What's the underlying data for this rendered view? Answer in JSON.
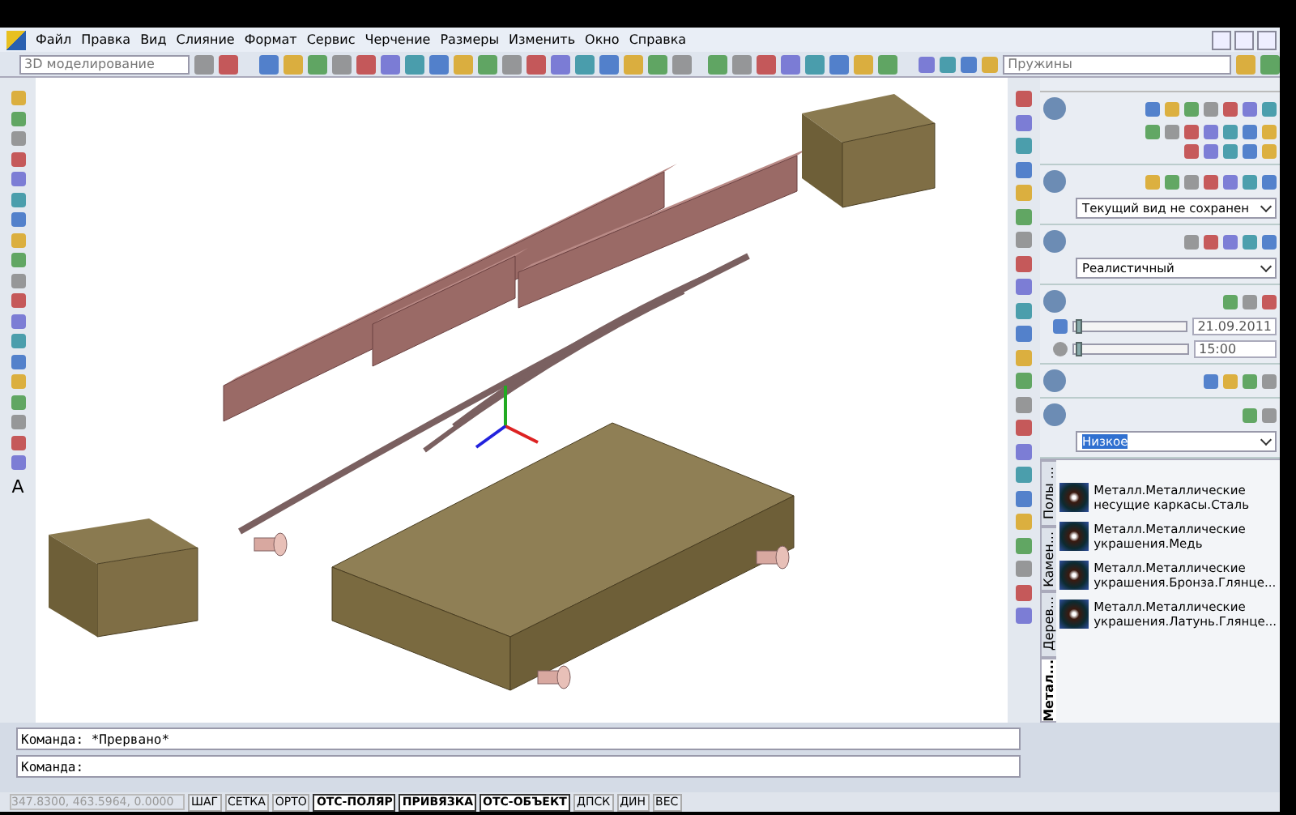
{
  "menu": [
    "Файл",
    "Правка",
    "Вид",
    "Слияние",
    "Формат",
    "Сервис",
    "Черчение",
    "Размеры",
    "Изменить",
    "Окно",
    "Справка"
  ],
  "toolbar": {
    "workspace": "3D моделирование",
    "layer": "Пружины"
  },
  "left_toolbar": {
    "text_tool": "A"
  },
  "palette": {
    "view": "Текущий вид не сохранен",
    "visual_style": "Реалистичный",
    "date": "21.09.2011",
    "date_slider": {
      "level": 0.02
    },
    "time": "15:00",
    "time_slider": {
      "level": 0.02
    },
    "render_quality": "Низкое"
  },
  "tool_palette": {
    "tabs": [
      {
        "label": "Полы ...",
        "selected": false
      },
      {
        "label": "Камен...",
        "selected": false
      },
      {
        "label": "Дерев...",
        "selected": false
      },
      {
        "label": "Метал...",
        "selected": true
      }
    ],
    "materials": [
      {
        "name": "Металл.Металлические несущие каркасы.Сталь"
      },
      {
        "name": "Металл.Металлические украшения.Медь"
      },
      {
        "name": "Металл.Металлические украшения.Бронза.Глянце..."
      },
      {
        "name": "Металл.Металлические украшения.Латунь.Глянце..."
      }
    ]
  },
  "command_lines": [
    "Команда: *Прервано*",
    "Команда:"
  ],
  "status_bar": {
    "coordinates": "347.8300, 463.5964, 0.0000",
    "buttons": [
      {
        "label": "ШАГ",
        "on": false
      },
      {
        "label": "СЕТКА",
        "on": false
      },
      {
        "label": "ОРТО",
        "on": false
      },
      {
        "label": "ОТС-ПОЛЯР",
        "on": true
      },
      {
        "label": "ПРИВЯЗКА",
        "on": true
      },
      {
        "label": "ОТС-ОБЪЕКТ",
        "on": true
      },
      {
        "label": "ДПСК",
        "on": false
      },
      {
        "label": "ДИН",
        "on": false
      },
      {
        "label": "ВЕС",
        "on": false
      }
    ]
  }
}
